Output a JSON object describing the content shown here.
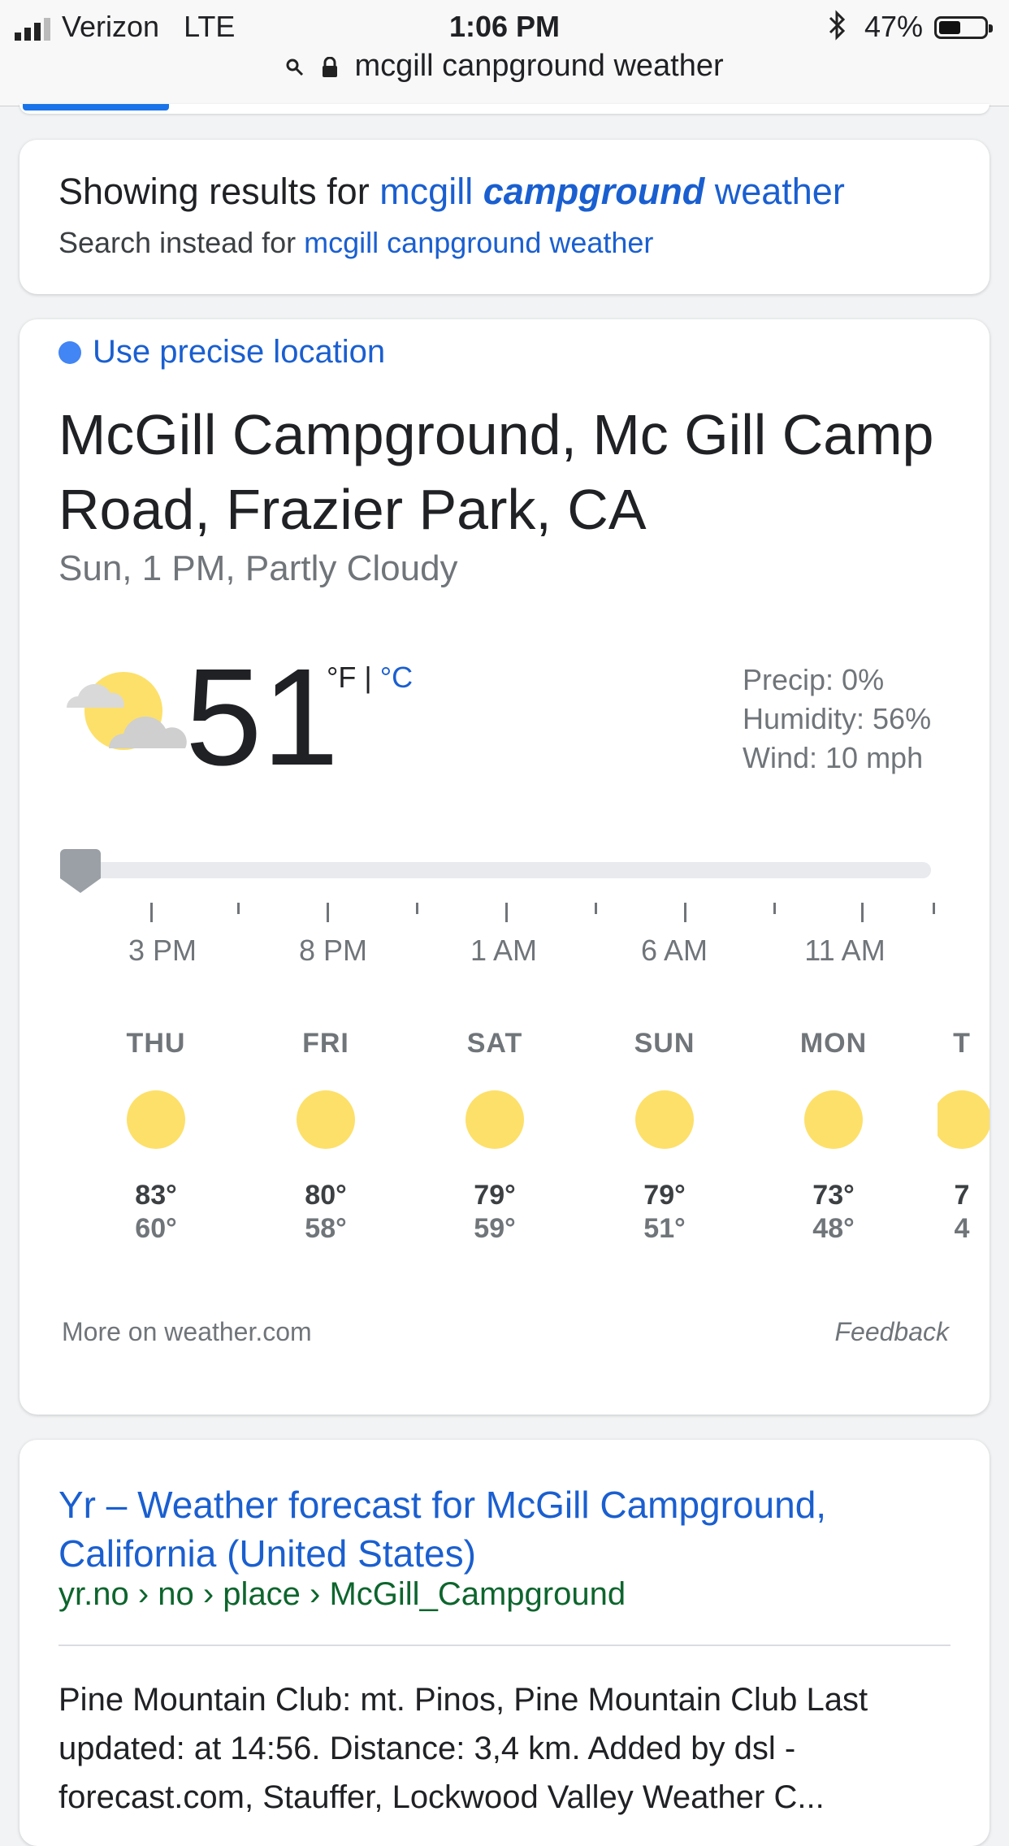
{
  "status": {
    "carrier": "Verizon   LTE",
    "time": "1:06 PM",
    "battery": "47%"
  },
  "url": {
    "text": "mcgill canpground weather"
  },
  "correction": {
    "prefix": "Showing results for ",
    "corrected_1": "mcgill ",
    "corrected_bold": "campground",
    "corrected_2": " weather",
    "instead_prefix": "Search instead for ",
    "instead_link": "mcgill canpground weather"
  },
  "weather": {
    "precise": "Use precise location",
    "place": "McGill Campground, Mc Gill Camp Road, Frazier Park, CA",
    "sub": "Sun, 1 PM, Partly Cloudy",
    "temp": "51",
    "unit_f": "°F",
    "unit_sep": " | ",
    "unit_c": "°C",
    "precip": "Precip: 0%",
    "humidity": "Humidity: 56%",
    "wind": "Wind: 10 mph",
    "slider_position": 0,
    "hours": [
      "3 PM",
      "8 PM",
      "1 AM",
      "6 AM",
      "11 AM"
    ],
    "days": [
      {
        "name": "THU",
        "hi": "83°",
        "lo": "60°"
      },
      {
        "name": "FRI",
        "hi": "80°",
        "lo": "58°"
      },
      {
        "name": "SAT",
        "hi": "79°",
        "lo": "59°"
      },
      {
        "name": "SUN",
        "hi": "79°",
        "lo": "51°"
      },
      {
        "name": "MON",
        "hi": "73°",
        "lo": "48°"
      },
      {
        "name": "T",
        "hi": "7",
        "lo": "4"
      }
    ],
    "more": "More on weather.com",
    "feedback": "Feedback",
    "colors": {
      "sun": "#fde06a",
      "link": "#1a5fd0"
    }
  },
  "result": {
    "title": "Yr – Weather forecast for McGill Campground, California (United States)",
    "url": "yr.no › no › place › McGill_Campground",
    "snippet": "Pine Mountain Club: mt. Pinos, Pine Mountain Club Last updated: at 14:56. Distance: 3,4 km. Added by dsl - forecast.com, Stauffer, Lockwood Valley Weather C..."
  }
}
